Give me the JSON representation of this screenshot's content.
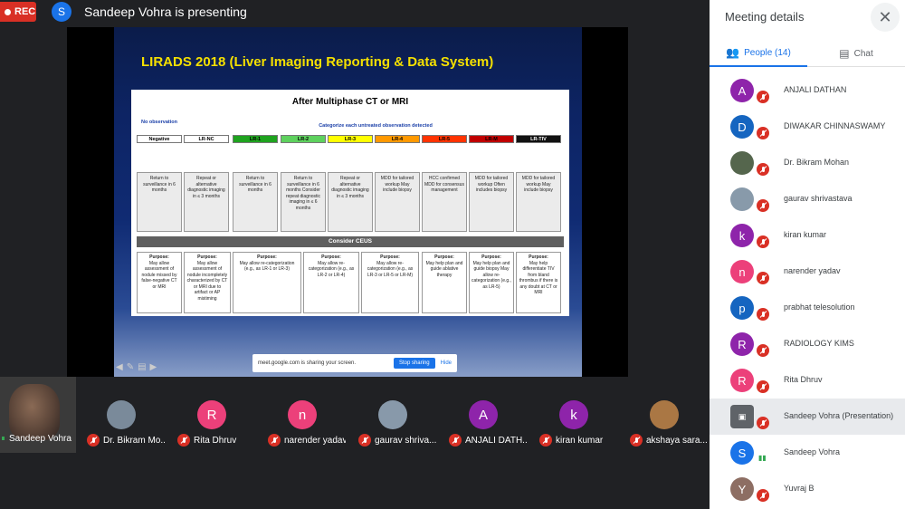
{
  "top": {
    "rec_label": "REC",
    "presenter_initial": "S",
    "presenting_text": "Sandeep Vohra is presenting"
  },
  "slide": {
    "title": "LIRADS  2018   (Liver Imaging Reporting & Data System)",
    "panel_title": "After Multiphase CT or MRI",
    "no_observation": "No observation",
    "categorize": "Categorize each untreated observation detected",
    "categories": [
      {
        "label": "Negative",
        "color": "#ffffff",
        "text": "#000"
      },
      {
        "label": "LR-NC",
        "color": "#ffffff",
        "text": "#000"
      },
      {
        "label": "LR-1",
        "color": "#1fa31f",
        "text": "#000"
      },
      {
        "label": "LR-2",
        "color": "#5ed15e",
        "text": "#000"
      },
      {
        "label": "LR-3",
        "color": "#ffff00",
        "text": "#000"
      },
      {
        "label": "LR-4",
        "color": "#ff9900",
        "text": "#000"
      },
      {
        "label": "LR-5",
        "color": "#ff3300",
        "text": "#000"
      },
      {
        "label": "LR-M",
        "color": "#c00000",
        "text": "#000"
      },
      {
        "label": "LR-TIV",
        "color": "#111111",
        "text": "#fff"
      }
    ],
    "actions": [
      "Return to surveillance in 6 months",
      "Repeat or alternative diagnostic imaging in ≤ 3 months",
      "Return to surveillance in 6 months",
      "Return to surveillance in 6 months  Consider repeat diagnostic imaging in ≤ 6 months",
      "Repeat or alternative diagnostic imaging in ≤ 3 months",
      "MDD for tailored workup  May include biopsy",
      "HCC confirmed  MDD for consensus management",
      "MDD for tailored workup  Often includes biopsy",
      "MDD for tailored workup  May include biopsy"
    ],
    "ceus": "Consider CEUS",
    "purpose_label": "Purpose:",
    "purposes": [
      "May allow assessment of nodule missed by false-negative CT or MRI",
      "May allow assessment of nodule incompletely characterized by CT or MRI due to artifact or AP mistiming",
      "May allow re-categorization (e.g., as LR-1 or LR-3)",
      "May allow re-categorization (e.g., as LR-2 or LR-4)",
      "May allow re-categorization (e.g., as LR-3 or LR-5 or LR-M)",
      "May help plan and guide ablative therapy",
      "May help plan and guide biopsy  May allow re-categorization (e.g., as LR-5)",
      "May help differentiate TIV from bland thrombus if there is any doubt at CT or MRI"
    ],
    "share_msg": "meet.google.com is sharing your screen.",
    "stop_sharing": "Stop sharing",
    "hide": "Hide"
  },
  "filmstrip": {
    "self_name": "Sandeep Vohra",
    "tiles": [
      {
        "name": "Dr. Bikram Mo...",
        "initial": "",
        "color": "#7a8a9a"
      },
      {
        "name": "Rita Dhruv",
        "initial": "R",
        "color": "#ec407a"
      },
      {
        "name": "narender yadav",
        "initial": "n",
        "color": "#ec407a"
      },
      {
        "name": "gaurav shriva...",
        "initial": "",
        "color": "#8899aa"
      },
      {
        "name": "ANJALI DATH...",
        "initial": "A",
        "color": "#8e24aa"
      },
      {
        "name": "kiran kumar",
        "initial": "k",
        "color": "#8e24aa"
      },
      {
        "name": "akshaya sara...",
        "initial": "",
        "color": "#aa7744"
      }
    ]
  },
  "side": {
    "title": "Meeting details",
    "close_icon": "✕",
    "tab_people": "People (14)",
    "tab_chat": "Chat",
    "people": [
      {
        "name": "ANJALI DATHAN",
        "initial": "A",
        "color": "#8e24aa",
        "type": "letter"
      },
      {
        "name": "DIWAKAR CHINNASWAMY",
        "initial": "D",
        "color": "#1565c0",
        "type": "letter"
      },
      {
        "name": "Dr. Bikram Mohan",
        "initial": "",
        "color": "#55664d",
        "type": "photo"
      },
      {
        "name": "gaurav shrivastava",
        "initial": "",
        "color": "#889aaa",
        "type": "photo"
      },
      {
        "name": "kiran kumar",
        "initial": "k",
        "color": "#8e24aa",
        "type": "letter"
      },
      {
        "name": "narender yadav",
        "initial": "n",
        "color": "#ec407a",
        "type": "letter"
      },
      {
        "name": "prabhat telesolution",
        "initial": "p",
        "color": "#1565c0",
        "type": "letter"
      },
      {
        "name": "RADIOLOGY KIMS",
        "initial": "R",
        "color": "#8e24aa",
        "type": "letter"
      },
      {
        "name": "Rita Dhruv",
        "initial": "R",
        "color": "#ec407a",
        "type": "letter"
      },
      {
        "name": "Sandeep Vohra (Presentation)",
        "initial": "▣",
        "color": "#5f6368",
        "type": "present"
      },
      {
        "name": "Sandeep Vohra",
        "initial": "S",
        "color": "#1a73e8",
        "type": "speaking"
      },
      {
        "name": "Yuvraj B",
        "initial": "Y",
        "color": "#8d6e63",
        "type": "letter"
      }
    ]
  }
}
